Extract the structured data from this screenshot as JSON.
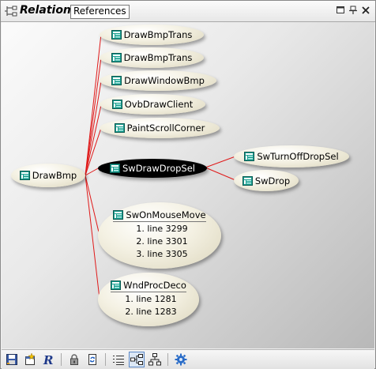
{
  "window": {
    "title": "Relation",
    "tab_label": "References"
  },
  "graph": {
    "root": {
      "label": "DrawBmp",
      "icon": "function-icon"
    },
    "callers_top": [
      {
        "label": "DrawBmpTrans",
        "icon": "function-icon"
      },
      {
        "label": "DrawBmpTrans",
        "icon": "function-icon"
      },
      {
        "label": "DrawWindowBmp",
        "icon": "function-icon"
      },
      {
        "label": "OvbDrawClient",
        "icon": "function-icon"
      },
      {
        "label": "PaintScrollCorner",
        "icon": "function-icon"
      }
    ],
    "selected": {
      "label": "SwDrawDropSel",
      "icon": "function-icon"
    },
    "selected_children": [
      {
        "label": "SwTurnOffDropSel",
        "icon": "function-icon"
      },
      {
        "label": "SwDrop",
        "icon": "function-icon"
      }
    ],
    "mouse_move": {
      "label": "SwOnMouseMove",
      "icon": "function-icon",
      "lines": [
        "line 3299",
        "line 3301",
        "line 3305"
      ]
    },
    "wnd_proc": {
      "label": "WndProcDeco",
      "icon": "function-icon",
      "lines": [
        "line 1281",
        "line 1283"
      ]
    }
  },
  "colors": {
    "link": "#e01818",
    "selected_fill": "#000000",
    "node_fill": "#f4f1e3"
  },
  "toolbar": {
    "icons": [
      "save-icon",
      "new-window-icon",
      "relation-r-icon",
      "lock-icon",
      "sync-icon",
      "list-view-icon",
      "horizontal-tree-icon",
      "vertical-tree-icon",
      "settings-icon"
    ],
    "pressed": "horizontal-tree-icon"
  }
}
